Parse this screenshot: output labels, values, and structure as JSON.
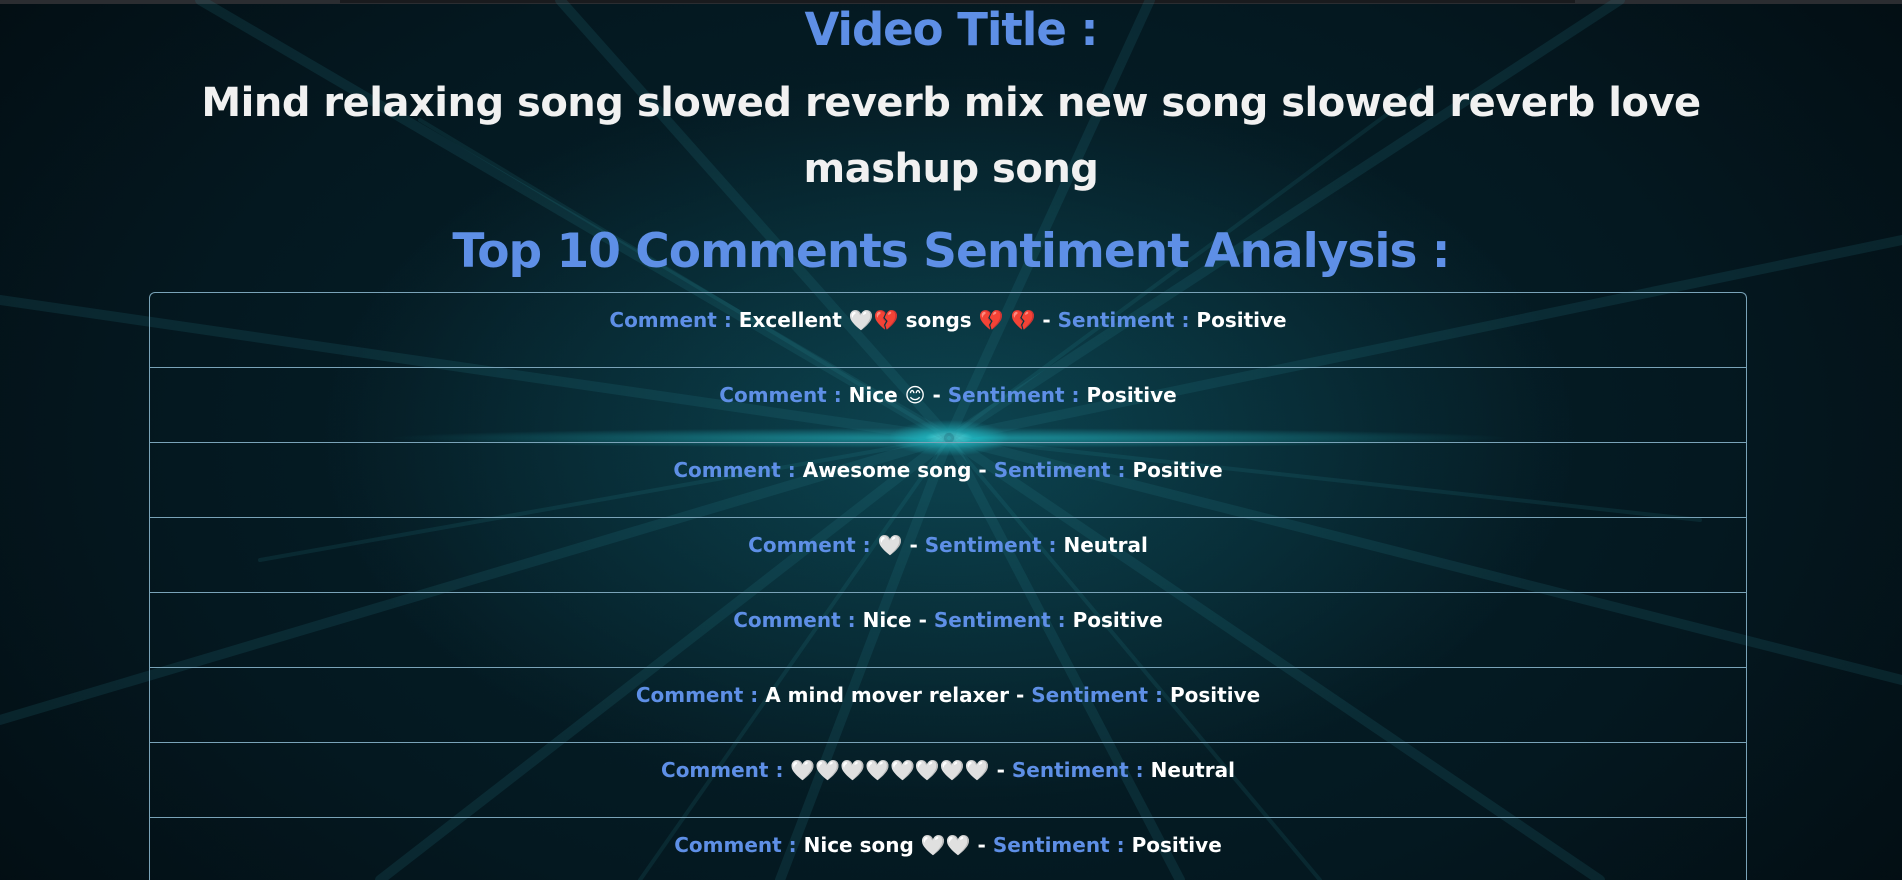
{
  "colors": {
    "accent": "#5e8fe6",
    "text": "#ffffff",
    "background": "#041820",
    "border": "#7aa3b8"
  },
  "page": {
    "video_heading": "Video Title :",
    "video_title": "Mind relaxing song slowed reverb mix new song slowed reverb love mashup song",
    "analysis_heading": "Top 10 Comments Sentiment Analysis :",
    "comment_label": "Comment :",
    "separator": "-",
    "sentiment_label": "Sentiment :"
  },
  "comments": [
    {
      "text": "Excellent 🤍💔 songs 💔 💔",
      "sentiment": "Positive"
    },
    {
      "text": "Nice 😊",
      "sentiment": "Positive"
    },
    {
      "text": "Awesome song",
      "sentiment": "Positive"
    },
    {
      "text": "🤍",
      "sentiment": "Neutral"
    },
    {
      "text": "Nice",
      "sentiment": "Positive"
    },
    {
      "text": "A mind mover relaxer",
      "sentiment": "Positive"
    },
    {
      "text": "🤍🤍🤍🤍🤍🤍🤍🤍",
      "sentiment": "Neutral"
    },
    {
      "text": "Nice song 🤍🤍",
      "sentiment": "Positive"
    }
  ]
}
